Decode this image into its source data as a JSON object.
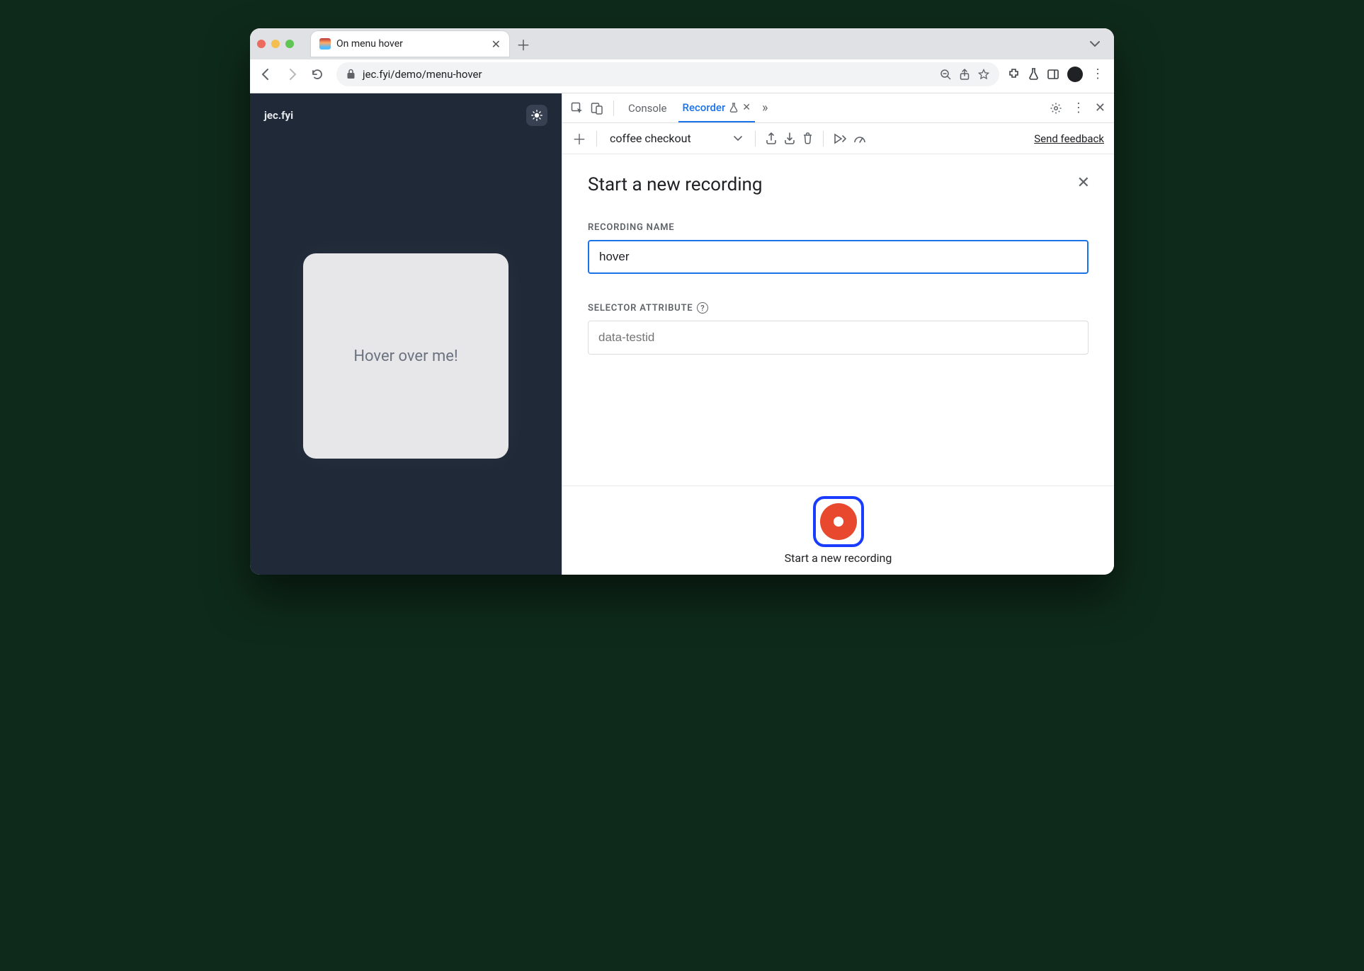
{
  "browser": {
    "tab_title": "On menu hover",
    "url_display": "jec.fyi/demo/menu-hover"
  },
  "page": {
    "brand": "jec.fyi",
    "card_text": "Hover over me!"
  },
  "devtools": {
    "tabs": {
      "console": "Console",
      "recorder": "Recorder"
    },
    "recording_select": "coffee checkout",
    "feedback_link": "Send feedback",
    "panel": {
      "title": "Start a new recording",
      "name_label": "RECORDING NAME",
      "name_value": "hover",
      "selector_label": "SELECTOR ATTRIBUTE",
      "selector_placeholder": "data-testid"
    },
    "record_button_label": "Start a new recording"
  }
}
